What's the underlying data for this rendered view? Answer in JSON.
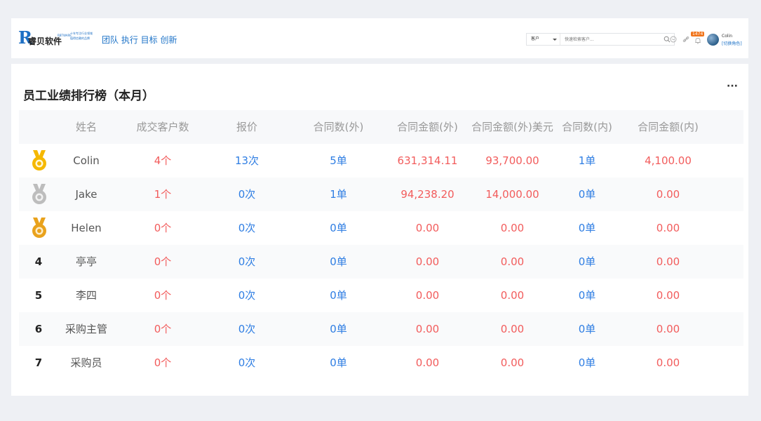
{
  "header": {
    "logo_mark": "R",
    "logo_name": "睿贝软件",
    "logo_site": "RBTWARE",
    "logo_tagline_1": "十年专注行业领域",
    "logo_tagline_2": "值得信赖的品牌",
    "slogan": "团队 执行 目标 创新",
    "search": {
      "select_value": "客户",
      "placeholder": "快速检索客户..."
    },
    "notification_count": "1474",
    "user_name": "Colin",
    "switch_role": "[切换角色]"
  },
  "panel": {
    "title": "员工业绩排行榜（本月）",
    "more_label": "···"
  },
  "table": {
    "columns": [
      "",
      "姓名",
      "成交客户数",
      "报价",
      "合同数(外)",
      "合同金额(外)",
      "合同金额(外)美元",
      "合同数(内)",
      "合同金额(内)"
    ],
    "rows": [
      {
        "rank": "1",
        "medal": "gold",
        "name": "Colin",
        "deals": "4个",
        "quotes": "13次",
        "contracts_ext": "5单",
        "amount_ext": "631,314.11",
        "amount_ext_usd": "93,700.00",
        "contracts_int": "1单",
        "amount_int": "4,100.00"
      },
      {
        "rank": "2",
        "medal": "silver",
        "name": "Jake",
        "deals": "1个",
        "quotes": "0次",
        "contracts_ext": "1单",
        "amount_ext": "94,238.20",
        "amount_ext_usd": "14,000.00",
        "contracts_int": "0单",
        "amount_int": "0.00"
      },
      {
        "rank": "3",
        "medal": "bronze",
        "name": "Helen",
        "deals": "0个",
        "quotes": "0次",
        "contracts_ext": "0单",
        "amount_ext": "0.00",
        "amount_ext_usd": "0.00",
        "contracts_int": "0单",
        "amount_int": "0.00"
      },
      {
        "rank": "4",
        "medal": "",
        "name": "亭亭",
        "deals": "0个",
        "quotes": "0次",
        "contracts_ext": "0单",
        "amount_ext": "0.00",
        "amount_ext_usd": "0.00",
        "contracts_int": "0单",
        "amount_int": "0.00"
      },
      {
        "rank": "5",
        "medal": "",
        "name": "李四",
        "deals": "0个",
        "quotes": "0次",
        "contracts_ext": "0单",
        "amount_ext": "0.00",
        "amount_ext_usd": "0.00",
        "contracts_int": "0单",
        "amount_int": "0.00"
      },
      {
        "rank": "6",
        "medal": "",
        "name": "采购主管",
        "deals": "0个",
        "quotes": "0次",
        "contracts_ext": "0单",
        "amount_ext": "0.00",
        "amount_ext_usd": "0.00",
        "contracts_int": "0单",
        "amount_int": "0.00"
      },
      {
        "rank": "7",
        "medal": "",
        "name": "采购员",
        "deals": "0个",
        "quotes": "0次",
        "contracts_ext": "0单",
        "amount_ext": "0.00",
        "amount_ext_usd": "0.00",
        "contracts_int": "0单",
        "amount_int": "0.00"
      }
    ]
  },
  "colors": {
    "accent_blue": "#2f7ee3",
    "value_red": "#f25c5c",
    "badge_orange": "#f0741b",
    "medal_gold": "#f5b800",
    "medal_silver": "#bdbdbd",
    "medal_bronze": "#e9a21c"
  },
  "icons": [
    "search-icon",
    "chat-icon",
    "link-icon",
    "bell-icon",
    "more-icon",
    "medal-icon"
  ]
}
